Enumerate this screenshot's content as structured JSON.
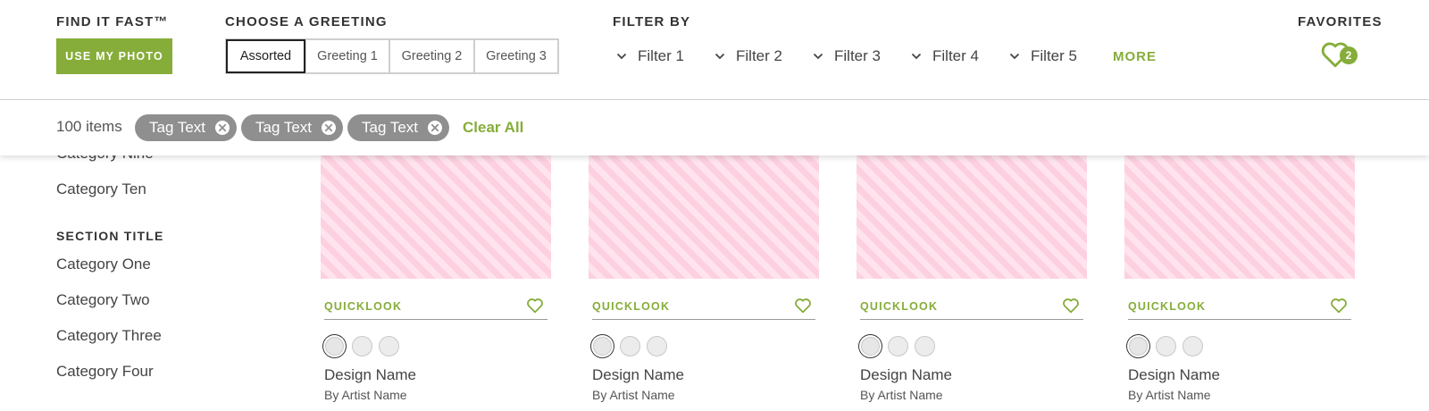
{
  "header": {
    "find_label": "FIND IT FAST™",
    "photo_button": "USE MY PHOTO",
    "greeting_label": "CHOOSE A GREETING",
    "greetings": [
      "Assorted",
      "Greeting 1",
      "Greeting 2",
      "Greeting 3"
    ],
    "greeting_selected": "Assorted",
    "filter_label": "FILTER BY",
    "filters": [
      "Filter 1",
      "Filter 2",
      "Filter 3",
      "Filter 4",
      "Filter 5"
    ],
    "more": "MORE",
    "favorites_label": "FAVORITES",
    "favorites_count": "2"
  },
  "tagbar": {
    "count": "100 items",
    "tags": [
      "Tag Text",
      "Tag Text",
      "Tag Text"
    ],
    "clear_all": "Clear All"
  },
  "sidebar": {
    "items_above": [
      "Category Nine",
      "Category Ten"
    ],
    "section_title": "SECTION TITLE",
    "items": [
      "Category One",
      "Category Two",
      "Category Three",
      "Category Four"
    ]
  },
  "products": [
    {
      "quicklook": "QUICKLOOK",
      "design": "Design Name",
      "artist": "By Artist Name"
    },
    {
      "quicklook": "QUICKLOOK",
      "design": "Design Name",
      "artist": "By Artist Name"
    },
    {
      "quicklook": "QUICKLOOK",
      "design": "Design Name",
      "artist": "By Artist Name"
    },
    {
      "quicklook": "QUICKLOOK",
      "design": "Design Name",
      "artist": "By Artist Name"
    }
  ],
  "colors": {
    "accent": "#86ad3a",
    "tag_bg": "#8f8f8f",
    "placeholder_stripe_a": "#fdd0e0",
    "placeholder_stripe_b": "#ffe3ee"
  },
  "icons": {
    "filter_chevron": "chevron-down-icon",
    "favorites": "heart-outline-icon",
    "tag_remove": "close-circle-icon",
    "card_favorite": "heart-outline-icon"
  }
}
